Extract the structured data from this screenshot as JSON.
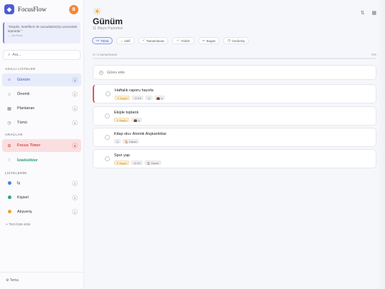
{
  "app": {
    "name": "FocusFlow",
    "logo_glyph": "◆",
    "user_initial": "B"
  },
  "quote": {
    "text": "\"Disiplin, hedeflerin ile somutluklar(in) arasındaki köprüdür.\"",
    "author": "— Jim Rohn"
  },
  "search": {
    "placeholder": "Ara..."
  },
  "sidebar": {
    "smart_lists_label": "AKILLI LİSTELER",
    "smart_lists": [
      {
        "label": "Günüm",
        "icon": "sun-icon",
        "count": "4"
      },
      {
        "label": "Önemli",
        "icon": "star-icon",
        "count": "2"
      },
      {
        "label": "Planlanan",
        "icon": "calendar-icon",
        "count": "4"
      },
      {
        "label": "Tümü",
        "icon": "clock-icon",
        "count": "4"
      }
    ],
    "tools_label": "ARAÇLAR",
    "tools": [
      {
        "label": "Focus Timer",
        "icon": "timer-icon",
        "count": "0"
      },
      {
        "label": "İstatistikler",
        "icon": "chart-icon"
      }
    ],
    "lists_label": "LİSTELERİM",
    "lists": [
      {
        "label": "İş",
        "color": "#4f7de0",
        "count": "2"
      },
      {
        "label": "Kişisel",
        "color": "#2ea86f",
        "count": "3"
      },
      {
        "label": "Alışveriş",
        "color": "#f0a02a",
        "count": "1"
      }
    ],
    "add_list": "+  Yeni liste ekle",
    "theme": "⚙  Tema"
  },
  "main": {
    "title": "Günüm",
    "date": "11 Mayıs Pazartesi",
    "filters": [
      {
        "label": "Tümü",
        "icon": "▭"
      },
      {
        "label": "Aktif",
        "icon": "○"
      },
      {
        "label": "Tamamlanan",
        "icon": "✓"
      },
      {
        "label": "Yıldızlı",
        "icon": "☆"
      },
      {
        "label": "Bugün",
        "icon": "▭"
      },
      {
        "label": "Gecikmiş",
        "icon": "◷"
      }
    ],
    "progress_label": "0 / 4 tamamlandı",
    "progress_percent": "0%",
    "progress_fraction": 0,
    "add_task_placeholder": "Görev ekle",
    "tasks": [
      {
        "title": "Haftalık raporu hazırla",
        "priority": true,
        "tags": [
          "☀ Bugün",
          "☑ 0/3",
          "◷",
          "💼 İş"
        ]
      },
      {
        "title": "Ekiple toplantı",
        "priority": false,
        "tags": [
          "☀ Bugün",
          "💼 İş"
        ]
      },
      {
        "title": "Kitap oku: Atomik Alışkanlıklar",
        "priority": false,
        "tags": [
          "◷",
          "🏠 Kişisel"
        ]
      },
      {
        "title": "Spor yap",
        "priority": false,
        "tags": [
          "☀ Bugün",
          "☑ 0/2",
          "🏠 Kişisel"
        ]
      }
    ]
  }
}
